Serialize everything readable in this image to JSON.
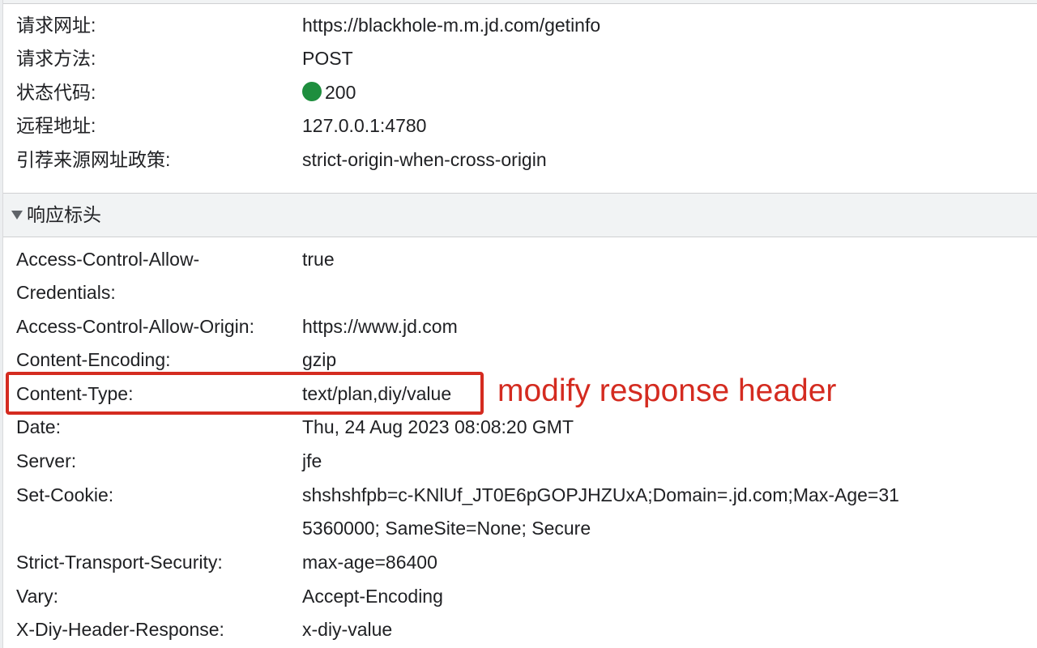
{
  "general": {
    "rows": [
      {
        "key": "请求网址:",
        "value": "https://blackhole-m.m.jd.com/getinfo"
      },
      {
        "key": "请求方法:",
        "value": "POST"
      },
      {
        "key": "状态代码:",
        "value": "200"
      },
      {
        "key": "远程地址:",
        "value": "127.0.0.1:4780"
      },
      {
        "key": "引荐来源网址政策:",
        "value": "strict-origin-when-cross-origin"
      }
    ],
    "status_color": "#1e8e3e"
  },
  "response_headers": {
    "title": "响应标头",
    "rows": [
      {
        "key": "Access-Control-Allow-Credentials:",
        "value": "true"
      },
      {
        "key": "Access-Control-Allow-Origin:",
        "value": "https://www.jd.com"
      },
      {
        "key": "Content-Encoding:",
        "value": "gzip"
      },
      {
        "key": "Content-Type:",
        "value": "text/plan,diy/value"
      },
      {
        "key": "Date:",
        "value": "Thu, 24 Aug 2023 08:08:20 GMT"
      },
      {
        "key": "Server:",
        "value": "jfe"
      },
      {
        "key": "Set-Cookie:",
        "value": "shshshfpb=c-KNlUf_JT0E6pGOPJHZUxA;Domain=.jd.com;Max-Age=315360000; SameSite=None; Secure"
      },
      {
        "key": "Strict-Transport-Security:",
        "value": "max-age=86400"
      },
      {
        "key": "Vary:",
        "value": "Accept-Encoding"
      },
      {
        "key": "X-Diy-Header-Response:",
        "value": "x-diy-value"
      }
    ]
  },
  "annotation": {
    "text": "modify response header",
    "color": "#d42b20"
  }
}
